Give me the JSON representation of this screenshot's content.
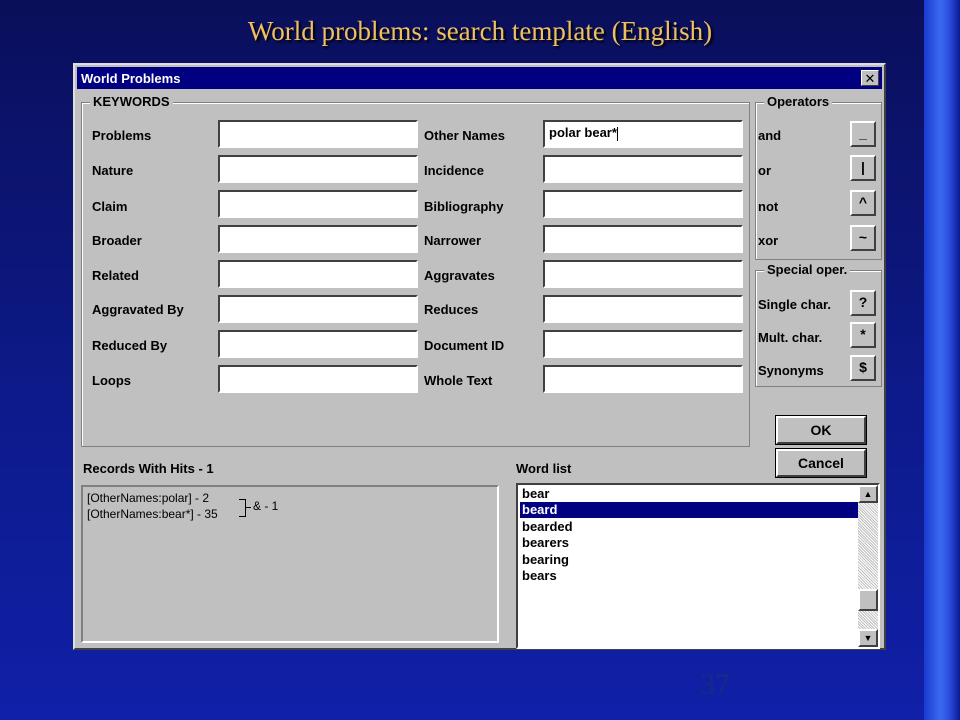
{
  "slide": {
    "title": "World problems: search template (English)",
    "number": "37"
  },
  "dialog": {
    "title": "World Problems",
    "close": "✕",
    "keywords": {
      "group_title": "KEYWORDS",
      "left": [
        {
          "label": "Problems",
          "value": ""
        },
        {
          "label": "Nature",
          "value": ""
        },
        {
          "label": "Claim",
          "value": ""
        },
        {
          "label": "Broader",
          "value": ""
        },
        {
          "label": "Related",
          "value": ""
        },
        {
          "label": "Aggravated By",
          "value": ""
        },
        {
          "label": "Reduced By",
          "value": ""
        },
        {
          "label": "Loops",
          "value": ""
        }
      ],
      "right": [
        {
          "label": "Other Names",
          "value": "polar bear*"
        },
        {
          "label": "Incidence",
          "value": ""
        },
        {
          "label": "Bibliography",
          "value": ""
        },
        {
          "label": "Narrower",
          "value": ""
        },
        {
          "label": "Aggravates",
          "value": ""
        },
        {
          "label": "Reduces",
          "value": ""
        },
        {
          "label": "Document ID",
          "value": ""
        },
        {
          "label": "Whole Text",
          "value": ""
        }
      ]
    },
    "operators": {
      "group_title": "Operators",
      "items": [
        {
          "label": "and",
          "symbol": "_"
        },
        {
          "label": "or",
          "symbol": "|"
        },
        {
          "label": "not",
          "symbol": "^"
        },
        {
          "label": "xor",
          "symbol": "~"
        }
      ]
    },
    "special": {
      "group_title": "Special oper.",
      "items": [
        {
          "label": "Single char.",
          "symbol": "?"
        },
        {
          "label": "Mult. char.",
          "symbol": "*"
        },
        {
          "label": "Synonyms",
          "symbol": "$"
        }
      ]
    },
    "ok_label": "OK",
    "cancel_label": "Cancel",
    "records": {
      "label": "Records With Hits - 1",
      "lines": [
        "[OtherNames:polar] - 2",
        "[OtherNames:bear*] - 35"
      ],
      "combined": "& - 1"
    },
    "wordlist": {
      "label": "Word list",
      "items": [
        "bear",
        "beard",
        "bearded",
        "bearers",
        "bearing",
        "bears"
      ],
      "selected_index": 1,
      "scroll_up": "▲",
      "scroll_down": "▼"
    }
  }
}
